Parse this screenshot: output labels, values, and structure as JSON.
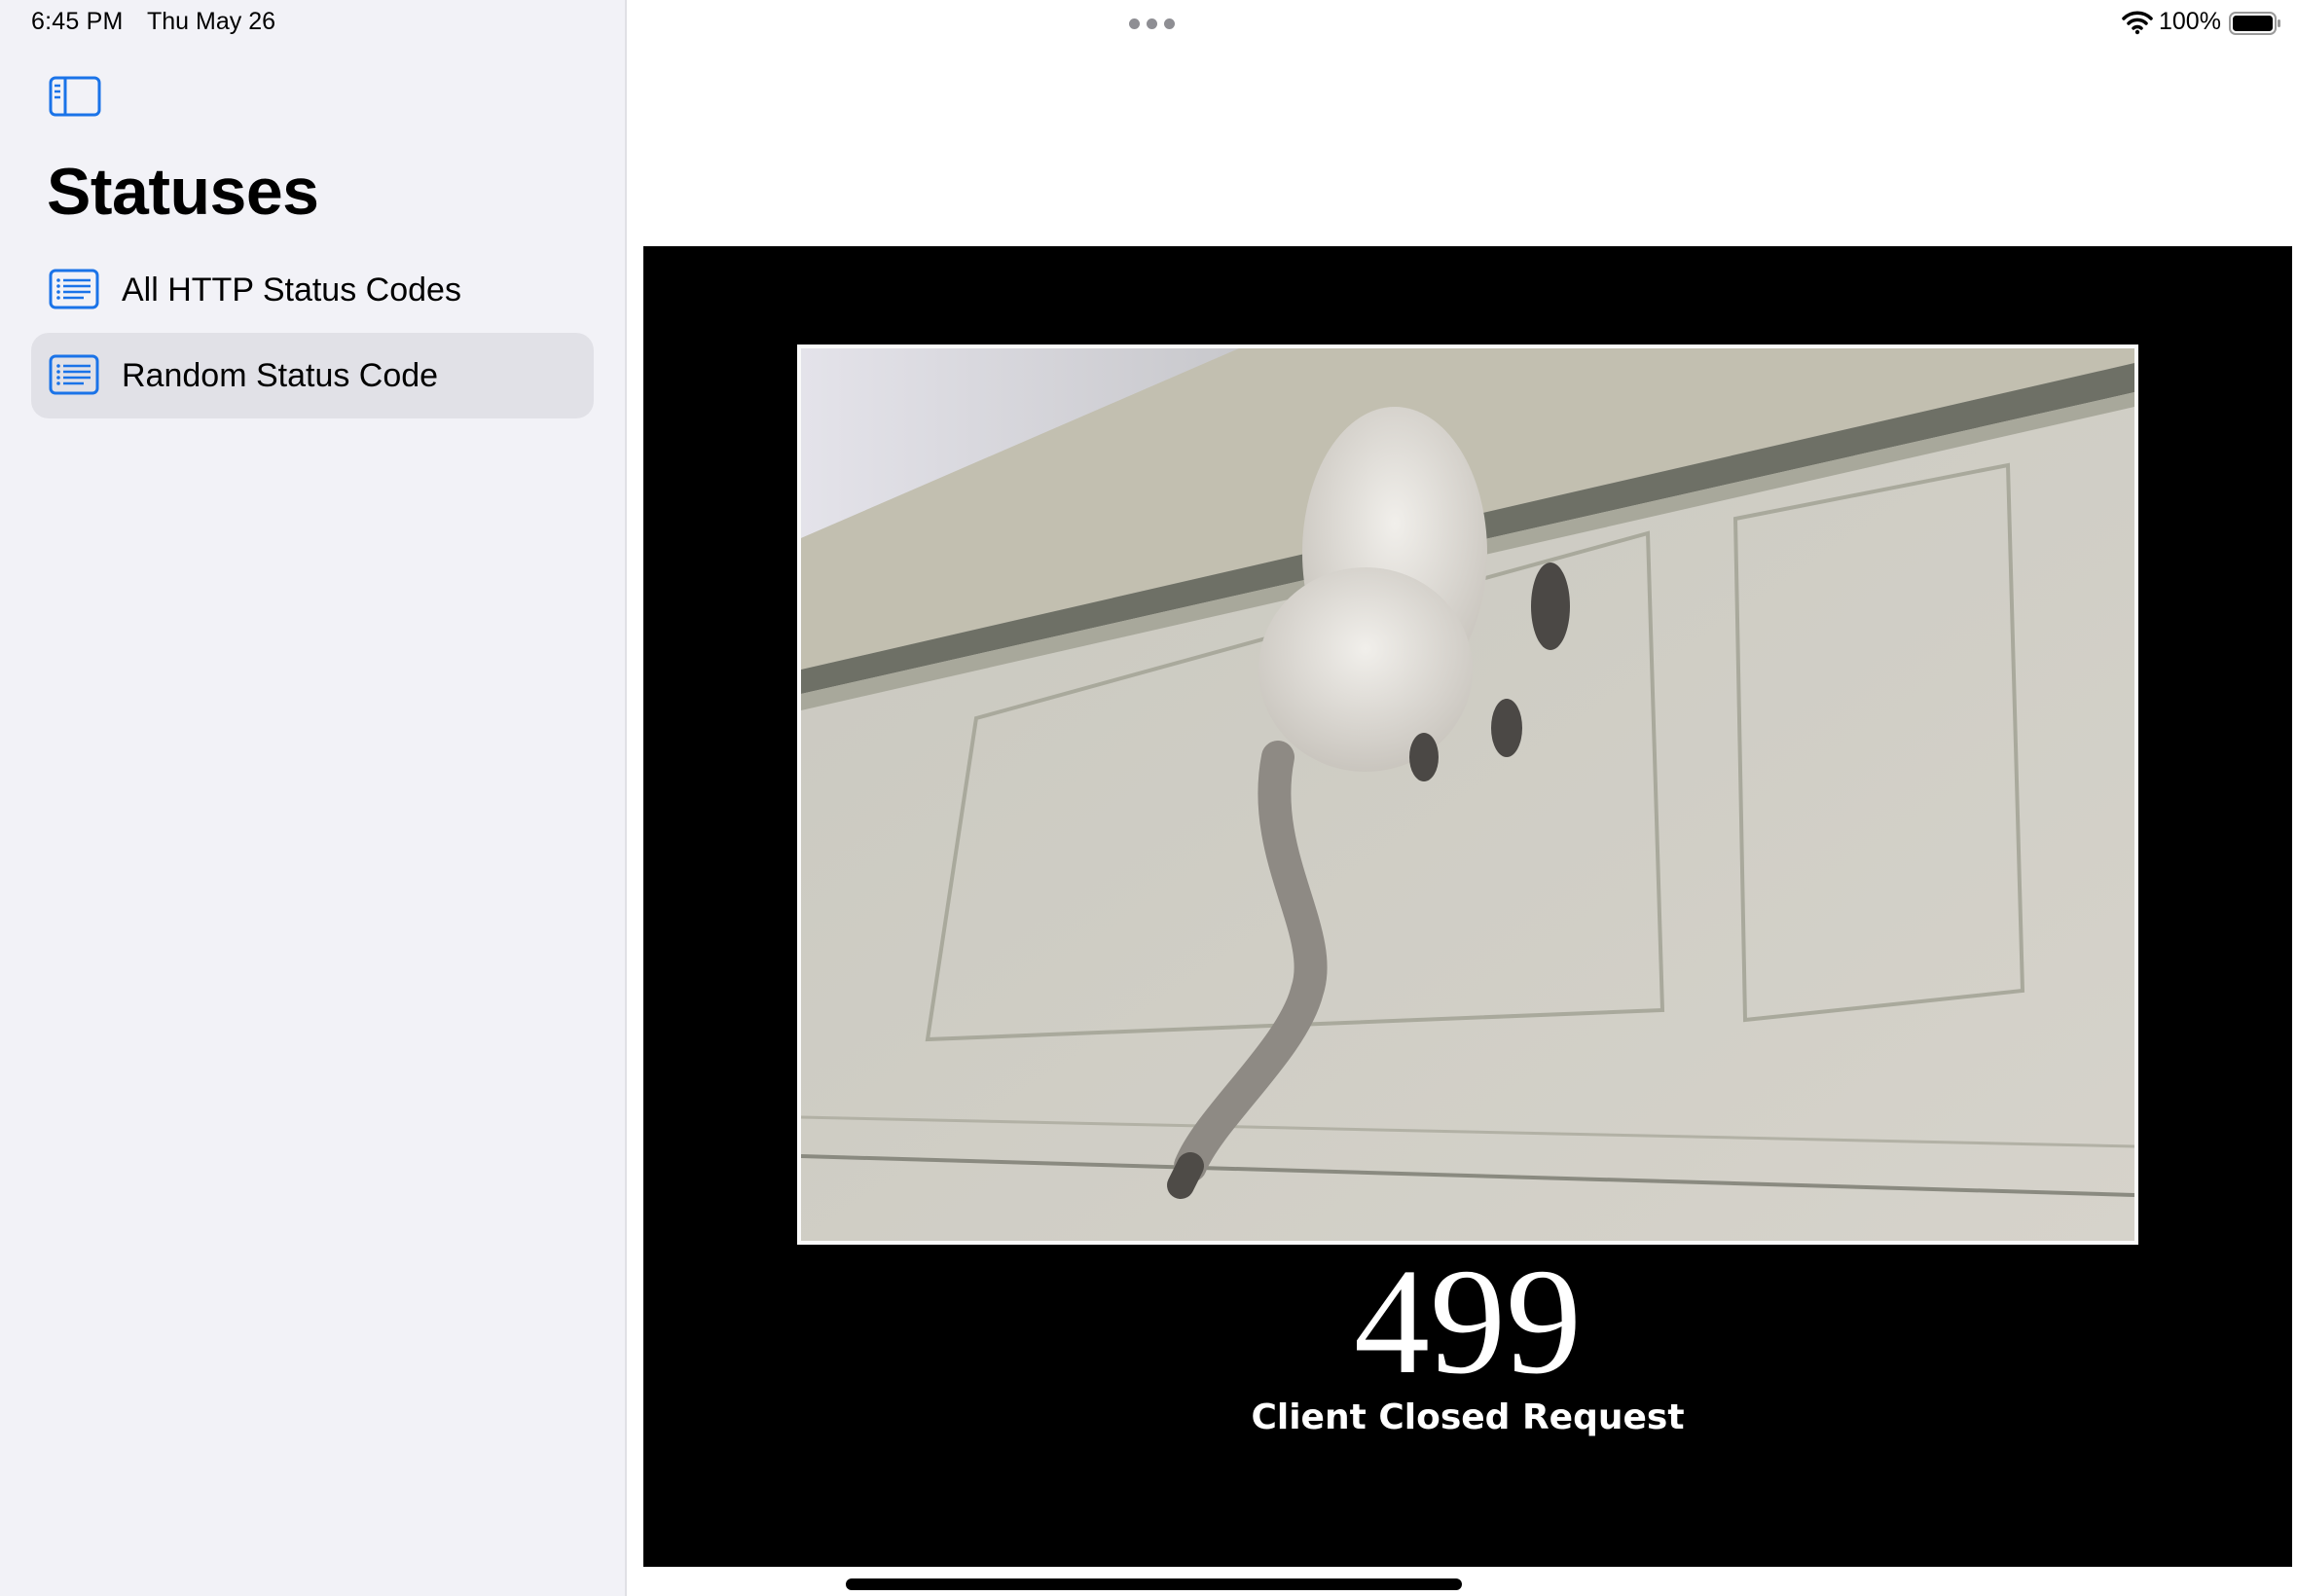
{
  "status_bar": {
    "time": "6:45 PM",
    "date": "Thu May 26",
    "battery": "100%"
  },
  "sidebar": {
    "title": "Statuses",
    "items": [
      {
        "label": "All HTTP Status Codes",
        "icon": "list-icon",
        "selected": false
      },
      {
        "label": "Random Status Code",
        "icon": "list-icon",
        "selected": true
      }
    ]
  },
  "detail": {
    "status_code": "499",
    "status_text": "Client Closed Request",
    "image": "cat-climbing-into-garage-door-photo"
  },
  "colors": {
    "accent": "#1a73e8",
    "sidebar_bg": "#f2f2f7",
    "selected_bg": "#e1e1e7",
    "poster_bg": "#000000"
  }
}
